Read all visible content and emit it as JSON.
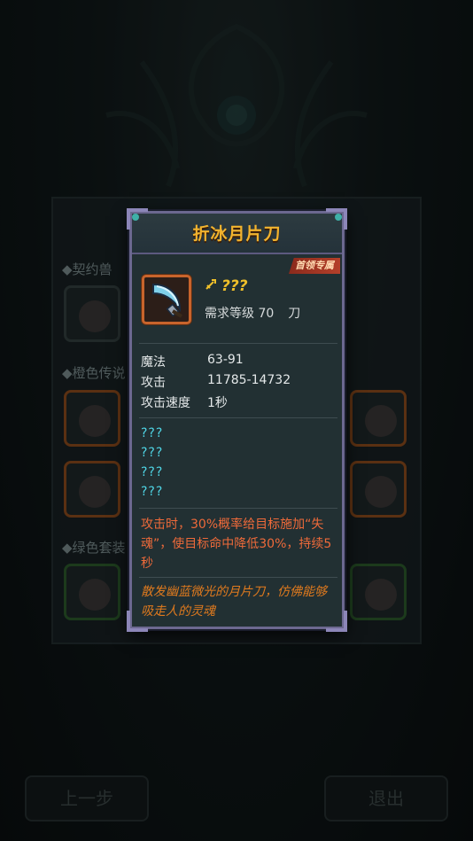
{
  "background": {
    "sections": [
      "◆契约兽",
      "◆橙色传说",
      "◆绿色套装"
    ],
    "buttons": {
      "back": "上一步",
      "exit": "退出"
    }
  },
  "popup": {
    "title": "折冰月片刀",
    "badge": "首领专属",
    "quality_icon": "sword-quality-icon",
    "quality_text": "???",
    "requirement_label": "需求等级 70",
    "weapon_type": "刀",
    "stats": [
      {
        "name": "魔法",
        "value": "63-91"
      },
      {
        "name": "攻击",
        "value": "11785-14732"
      },
      {
        "name": "攻击速度",
        "value": "1秒"
      }
    ],
    "unknown_lines": [
      "???",
      "???",
      "???",
      "???"
    ],
    "effect": "攻击时，30%概率给目标施加“失魂”，使目标命中降低30%，持续5秒",
    "lore": "散发幽蓝微光的月片刀，仿佛能够吸走人的灵魂"
  },
  "colors": {
    "title": "#f2b32e",
    "quality": "#f0c02a",
    "unknown": "#4fd6e6",
    "effect": "#ee6a3a",
    "lore": "#e07a1e",
    "frame": "#6c6890"
  }
}
